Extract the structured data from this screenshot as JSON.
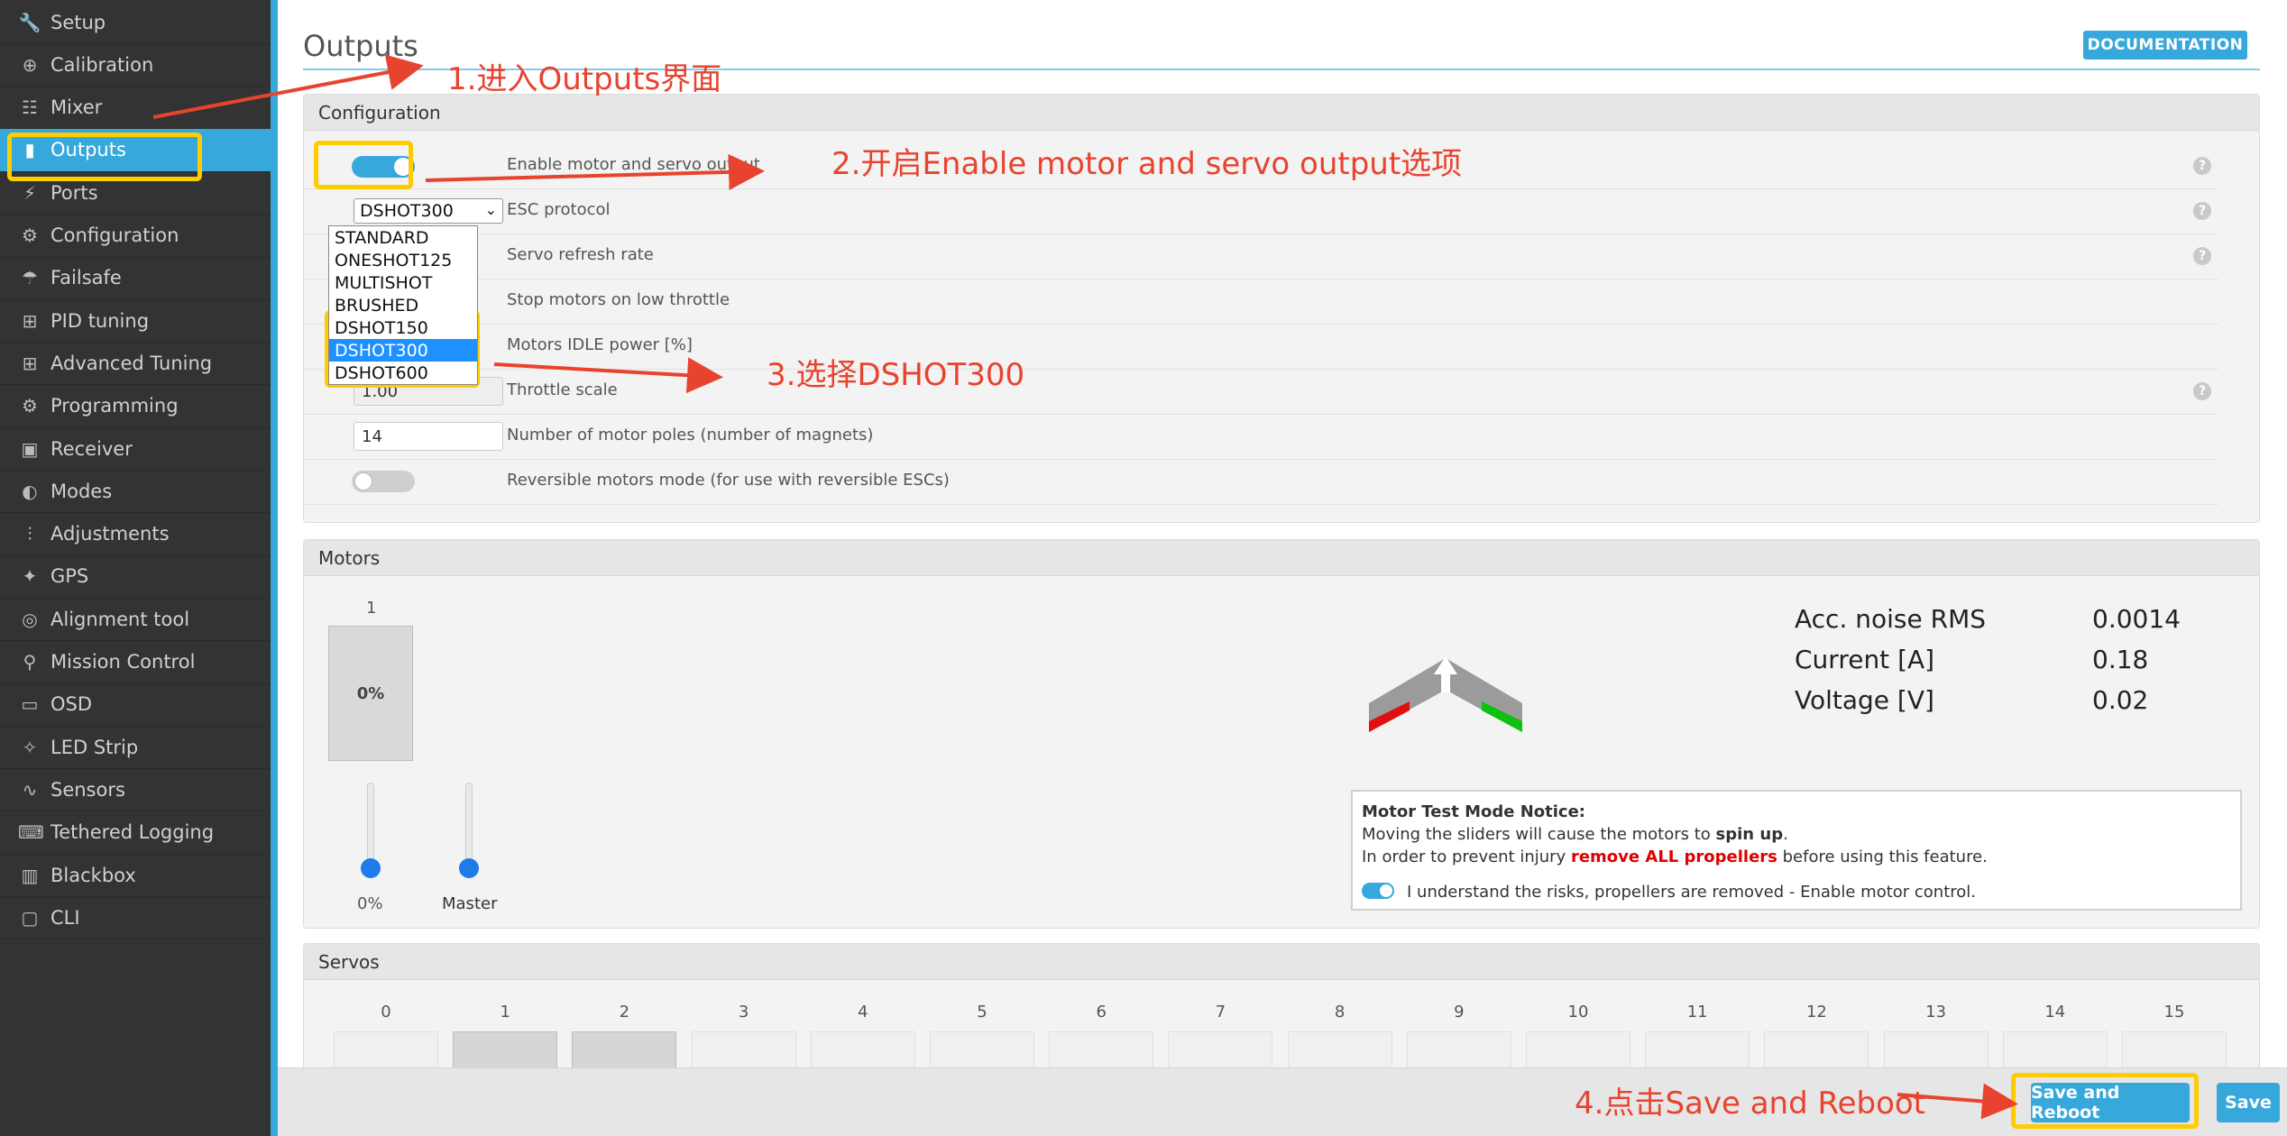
{
  "sidebar": {
    "items": [
      {
        "label": "Setup",
        "icon": "wrench-icon"
      },
      {
        "label": "Calibration",
        "icon": "crosshair-icon"
      },
      {
        "label": "Mixer",
        "icon": "mixer-icon"
      },
      {
        "label": "Outputs",
        "icon": "outputs-icon"
      },
      {
        "label": "Ports",
        "icon": "plug-icon"
      },
      {
        "label": "Configuration",
        "icon": "gear-icon"
      },
      {
        "label": "Failsafe",
        "icon": "parachute-icon"
      },
      {
        "label": "PID tuning",
        "icon": "sitemap-icon"
      },
      {
        "label": "Advanced Tuning",
        "icon": "sitemap-icon"
      },
      {
        "label": "Programming",
        "icon": "gear-icon"
      },
      {
        "label": "Receiver",
        "icon": "receiver-icon"
      },
      {
        "label": "Modes",
        "icon": "toggle-icon"
      },
      {
        "label": "Adjustments",
        "icon": "sliders-icon"
      },
      {
        "label": "GPS",
        "icon": "satellite-icon"
      },
      {
        "label": "Alignment tool",
        "icon": "compass-icon"
      },
      {
        "label": "Mission Control",
        "icon": "map-pin-icon"
      },
      {
        "label": "OSD",
        "icon": "osd-icon"
      },
      {
        "label": "LED Strip",
        "icon": "led-icon"
      },
      {
        "label": "Sensors",
        "icon": "pulse-icon"
      },
      {
        "label": "Tethered Logging",
        "icon": "keyboard-icon"
      },
      {
        "label": "Blackbox",
        "icon": "blackbox-icon"
      },
      {
        "label": "CLI",
        "icon": "terminal-icon"
      }
    ],
    "active_index": 3
  },
  "page": {
    "title": "Outputs",
    "documentation_button": "DOCUMENTATION"
  },
  "configuration": {
    "heading": "Configuration",
    "enable_output_label": "Enable motor and servo output",
    "esc_protocol_label": "ESC protocol",
    "esc_protocol_value": "DSHOT300",
    "esc_protocol_options": [
      "STANDARD",
      "ONESHOT125",
      "MULTISHOT",
      "BRUSHED",
      "DSHOT150",
      "DSHOT300",
      "DSHOT600"
    ],
    "servo_refresh_label": "Servo refresh rate",
    "stop_motors_label": "Stop motors on low throttle",
    "idle_power_label": "Motors IDLE power [%]",
    "throttle_scale_label": "Throttle scale",
    "throttle_scale_value": "1.00",
    "motor_poles_label": "Number of motor poles (number of magnets)",
    "motor_poles_value": "14",
    "reversible_label": "Reversible motors mode (for use with reversible ESCs)",
    "help_glyph": "?"
  },
  "motors": {
    "heading": "Motors",
    "motor_number": "1",
    "motor_value": "0%",
    "slider_value_label": "0%",
    "master_label": "Master",
    "stats": [
      {
        "label": "Acc. noise RMS",
        "value": "0.0014"
      },
      {
        "label": "Current [A]",
        "value": "0.18"
      },
      {
        "label": "Voltage [V]",
        "value": "0.02"
      }
    ],
    "notice_title": "Motor Test Mode Notice:",
    "notice_line1_a": "Moving the sliders will cause the motors to ",
    "notice_line1_b": "spin up",
    "notice_line1_c": ".",
    "notice_line2_a": "In order to prevent injury ",
    "notice_line2_b": "remove ALL propellers",
    "notice_line2_c": " before using this feature.",
    "notice_toggle_label": "I understand the risks, propellers are removed - Enable motor control."
  },
  "servos": {
    "heading": "Servos",
    "numbers": [
      "0",
      "1",
      "2",
      "3",
      "4",
      "5",
      "6",
      "7",
      "8",
      "9",
      "10",
      "11",
      "12",
      "13",
      "14",
      "15"
    ]
  },
  "footer": {
    "save_reboot": "Save and Reboot",
    "save": "Save"
  },
  "annotations": {
    "step1": "1.进入Outputs界面",
    "step2": "2.开启Enable motor and servo output选项",
    "step3": "3.选择DSHOT300",
    "step4": "4.点击Save and Reboot"
  },
  "colors": {
    "accent": "#37a8db",
    "sidebar_bg": "#333333",
    "highlight": "#ffcc00",
    "annotation": "#e8432e",
    "warning_text": "#e00000"
  }
}
